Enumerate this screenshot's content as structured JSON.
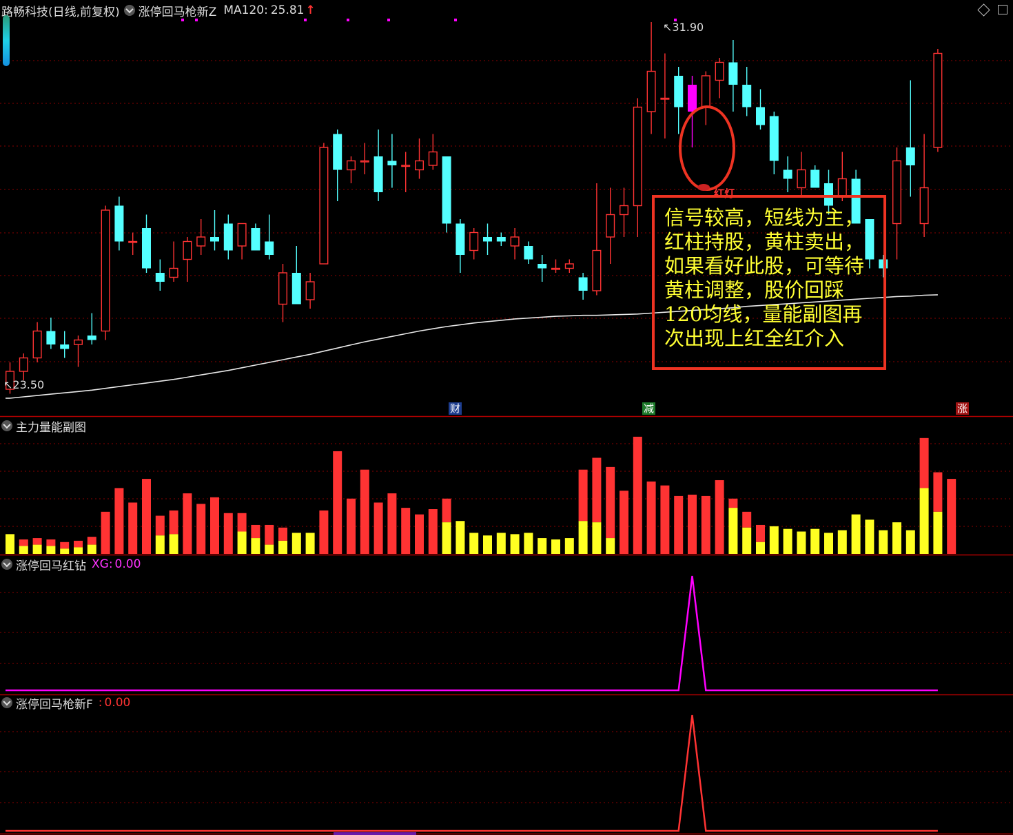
{
  "header": {
    "title": "路畅科技(日线,前复权)",
    "indicator_name": "涨停回马枪新Z",
    "ma_label": "MA120:",
    "ma_value": "25.81",
    "arrow": "↑"
  },
  "price_labels": {
    "high": "31.90",
    "low": "23.50"
  },
  "markers": {
    "cai": "财",
    "jian": "减",
    "zhang": "涨",
    "red_light": "红灯"
  },
  "annotation": {
    "text": "信号较高，短线为主，红柱持股，黄柱卖出，如果看好此股，可等待黄柱调整，股价回踩120均线，量能副图再次出现上红全红介入"
  },
  "panels": {
    "volume": {
      "title": "主力量能副图"
    },
    "red_diamond": {
      "title": "涨停回马红钻",
      "label": "XG:",
      "value": "0.00"
    },
    "spear": {
      "title": "涨停回马枪新F",
      "label": ":",
      "value": "0.00"
    }
  },
  "colors": {
    "up": "#ff3333",
    "down": "#54ffff",
    "yellow": "#ffff22",
    "magenta": "#ff00ff",
    "grid": "#8b0000"
  },
  "chart_data": {
    "type": "candlestick",
    "series": [
      {
        "name": "kline",
        "ohlc": [
          [
            23.7,
            24.3,
            23.6,
            24.1
          ],
          [
            24.1,
            24.5,
            23.9,
            24.4
          ],
          [
            24.4,
            25.2,
            24.3,
            25.0
          ],
          [
            25.0,
            25.3,
            24.6,
            24.7
          ],
          [
            24.7,
            25.0,
            24.4,
            24.6
          ],
          [
            24.7,
            24.9,
            24.2,
            24.8
          ],
          [
            24.9,
            25.4,
            24.7,
            24.8
          ],
          [
            25.0,
            27.8,
            24.8,
            27.7
          ],
          [
            27.8,
            28.0,
            26.8,
            27.0
          ],
          [
            27.0,
            27.2,
            26.7,
            27.0
          ],
          [
            27.3,
            27.6,
            26.3,
            26.4
          ],
          [
            26.3,
            26.6,
            25.9,
            26.1
          ],
          [
            26.2,
            27.0,
            26.1,
            26.4
          ],
          [
            26.6,
            27.1,
            26.1,
            27.0
          ],
          [
            26.9,
            27.5,
            26.7,
            27.1
          ],
          [
            27.1,
            27.7,
            26.8,
            27.0
          ],
          [
            27.4,
            27.6,
            26.6,
            26.8
          ],
          [
            26.9,
            27.4,
            26.6,
            27.4
          ],
          [
            27.3,
            27.4,
            26.8,
            26.8
          ],
          [
            27.0,
            27.6,
            26.6,
            26.7
          ],
          [
            25.6,
            26.5,
            25.2,
            26.3
          ],
          [
            26.3,
            26.9,
            25.6,
            25.6
          ],
          [
            25.7,
            26.3,
            25.5,
            26.1
          ],
          [
            26.5,
            29.2,
            26.5,
            29.1
          ],
          [
            29.4,
            29.5,
            27.9,
            28.6
          ],
          [
            28.6,
            28.9,
            28.3,
            28.8
          ],
          [
            28.8,
            29.2,
            28.5,
            28.8
          ],
          [
            28.9,
            29.5,
            27.9,
            28.1
          ],
          [
            28.8,
            29.4,
            28.2,
            28.7
          ],
          [
            28.7,
            29.0,
            28.1,
            28.7
          ],
          [
            28.6,
            29.3,
            28.4,
            28.8
          ],
          [
            28.7,
            29.4,
            28.6,
            29.0
          ],
          [
            28.9,
            28.9,
            27.2,
            27.4
          ],
          [
            27.4,
            27.5,
            26.3,
            26.7
          ],
          [
            26.8,
            27.3,
            26.6,
            27.2
          ],
          [
            27.1,
            27.4,
            26.7,
            27.0
          ],
          [
            27.1,
            27.2,
            26.9,
            27.0
          ],
          [
            26.9,
            27.3,
            26.6,
            27.1
          ],
          [
            26.9,
            27.0,
            26.5,
            26.6
          ],
          [
            26.5,
            26.7,
            26.1,
            26.4
          ],
          [
            26.4,
            26.6,
            26.3,
            26.4
          ],
          [
            26.4,
            26.6,
            26.3,
            26.5
          ],
          [
            26.2,
            26.3,
            25.7,
            25.9
          ],
          [
            25.9,
            28.3,
            25.8,
            26.8
          ],
          [
            27.1,
            28.2,
            26.5,
            27.6
          ],
          [
            27.6,
            28.2,
            27.1,
            27.8
          ],
          [
            27.8,
            30.2,
            27.1,
            30.0
          ],
          [
            29.9,
            31.9,
            29.4,
            30.8
          ],
          [
            30.2,
            31.2,
            29.3,
            30.2
          ],
          [
            30.7,
            30.9,
            29.4,
            30.0
          ],
          [
            30.5,
            30.7,
            29.1,
            29.9
          ],
          [
            30.0,
            30.8,
            29.6,
            30.7
          ],
          [
            30.6,
            31.1,
            30.2,
            31.0
          ],
          [
            31.0,
            31.5,
            29.9,
            30.5
          ],
          [
            30.5,
            30.9,
            29.8,
            30.0
          ],
          [
            30.0,
            30.4,
            29.5,
            29.6
          ],
          [
            29.8,
            29.9,
            28.5,
            28.8
          ],
          [
            28.6,
            28.9,
            28.1,
            28.4
          ],
          [
            28.2,
            29.0,
            28.0,
            28.6
          ],
          [
            28.6,
            28.7,
            28.2,
            28.2
          ],
          [
            28.3,
            28.6,
            27.6,
            27.8
          ],
          [
            28.0,
            29.0,
            27.9,
            28.4
          ],
          [
            28.4,
            28.6,
            27.4,
            27.4
          ],
          [
            27.5,
            27.5,
            26.4,
            26.6
          ],
          [
            26.6,
            26.7,
            26.2,
            26.4
          ],
          [
            27.4,
            29.1,
            26.6,
            28.8
          ],
          [
            29.1,
            30.6,
            28.0,
            28.7
          ],
          [
            27.4,
            29.4,
            27.1,
            28.2
          ],
          [
            29.1,
            31.3,
            29.0,
            31.2
          ]
        ]
      },
      {
        "name": "MA120",
        "values": [
          23.5,
          23.53,
          23.56,
          23.59,
          23.62,
          23.65,
          23.68,
          23.72,
          23.76,
          23.8,
          23.84,
          23.88,
          23.92,
          23.97,
          24.02,
          24.07,
          24.12,
          24.18,
          24.24,
          24.3,
          24.36,
          24.42,
          24.48,
          24.55,
          24.62,
          24.69,
          24.76,
          24.82,
          24.88,
          24.94,
          25.0,
          25.05,
          25.1,
          25.14,
          25.18,
          25.21,
          25.24,
          25.27,
          25.29,
          25.31,
          25.33,
          25.34,
          25.35,
          25.35,
          25.36,
          25.37,
          25.38,
          25.4,
          25.42,
          25.44,
          25.46,
          25.48,
          25.5,
          25.52,
          25.55,
          25.57,
          25.59,
          25.61,
          25.63,
          25.65,
          25.67,
          25.69,
          25.71,
          25.73,
          25.75,
          25.77,
          25.78,
          25.8,
          25.81
        ]
      }
    ],
    "volume": {
      "total": [
        1.5,
        1.1,
        1.2,
        1.1,
        0.9,
        1.0,
        1.3,
        3.2,
        5.0,
        3.9,
        5.7,
        2.9,
        3.3,
        4.6,
        3.8,
        4.3,
        3.1,
        3.1,
        2.2,
        2.2,
        2.0,
        1.6,
        1.6,
        3.3,
        7.8,
        4.2,
        6.4,
        3.9,
        4.6,
        3.5,
        3.0,
        3.4,
        4.2,
        2.5,
        1.6,
        1.4,
        1.6,
        1.5,
        1.6,
        1.2,
        1.1,
        1.2,
        6.4,
        7.3,
        6.6,
        4.8,
        8.9,
        5.5,
        5.2,
        4.4,
        4.5,
        4.4,
        5.6,
        4.2,
        3.2,
        2.2,
        2.1,
        1.9,
        1.7,
        1.9,
        1.6,
        1.8,
        3.0,
        2.6,
        1.8,
        2.4,
        1.8,
        8.8,
        6.2,
        5.7
      ],
      "yellow": [
        1.5,
        0.6,
        0.7,
        0.6,
        0.4,
        0.5,
        0.7,
        0.0,
        0.0,
        0.0,
        0.0,
        1.4,
        1.5,
        0.0,
        0.0,
        0.0,
        0.0,
        1.7,
        1.2,
        0.7,
        1.0,
        1.6,
        1.6,
        0.0,
        0.0,
        0.0,
        0.0,
        0.0,
        0.0,
        0.0,
        0.0,
        0.0,
        2.4,
        2.5,
        1.6,
        1.4,
        1.6,
        1.5,
        1.6,
        1.2,
        1.1,
        1.2,
        2.5,
        2.4,
        1.2,
        0.0,
        0.0,
        0.0,
        0.0,
        0.0,
        0.0,
        0.0,
        0.0,
        3.5,
        2.0,
        0.9,
        2.1,
        1.9,
        1.7,
        1.9,
        1.6,
        1.8,
        3.0,
        2.6,
        1.8,
        2.4,
        1.8,
        5.0,
        3.2,
        0.0
      ]
    }
  }
}
